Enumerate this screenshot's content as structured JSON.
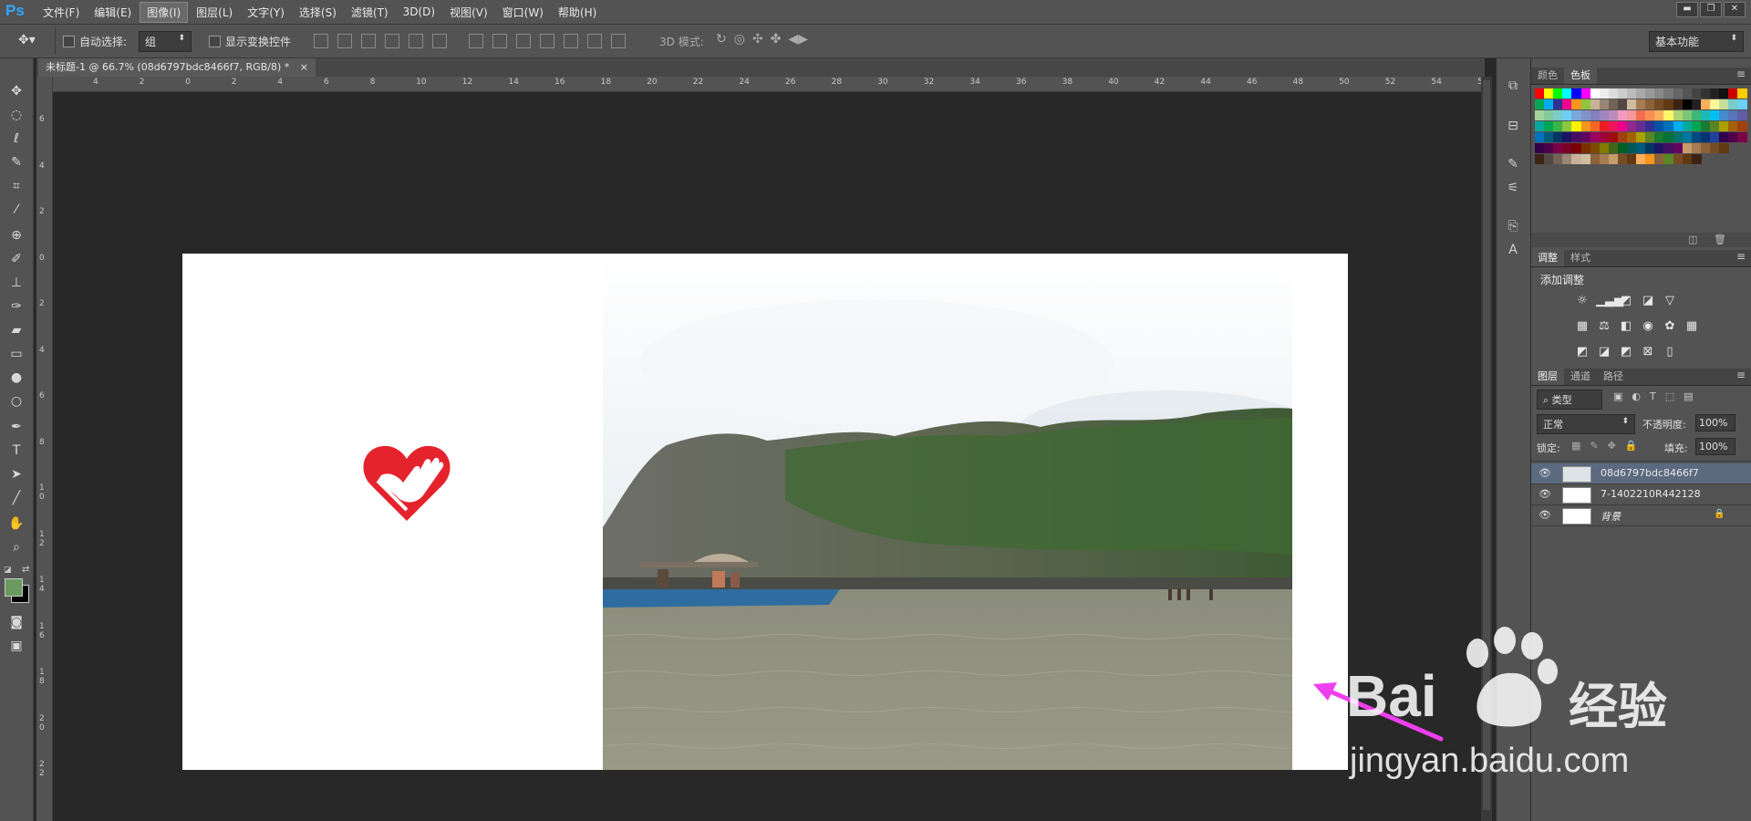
{
  "app": {
    "logo": "Ps"
  },
  "menu": {
    "items": [
      "文件(F)",
      "编辑(E)",
      "图像(I)",
      "图层(L)",
      "文字(Y)",
      "选择(S)",
      "滤镜(T)",
      "3D(D)",
      "视图(V)",
      "窗口(W)",
      "帮助(H)"
    ],
    "active_index": 2
  },
  "window_controls": {
    "minimize": "▬",
    "restore": "❐",
    "close": "✕"
  },
  "options": {
    "auto_select_label": "自动选择:",
    "auto_select_value": "组",
    "show_transform_label": "显示变换控件",
    "mode_3d_label": "3D 模式:",
    "workspace_value": "基本功能"
  },
  "document": {
    "tab_title": "未标题-1 @ 66.7% (08d6797bdc8466f7, RGB/8) *",
    "tab_close": "×"
  },
  "ruler": {
    "h_labels": [
      "4",
      "2",
      "0",
      "2",
      "4",
      "6",
      "8",
      "10",
      "12",
      "14",
      "16",
      "18",
      "20",
      "22",
      "24",
      "26",
      "28",
      "30",
      "32",
      "34",
      "36",
      "38",
      "40",
      "42",
      "44",
      "46",
      "48",
      "50",
      "52",
      "54",
      "5"
    ],
    "v_labels": [
      "6",
      "4",
      "2",
      "0",
      "2",
      "4",
      "6",
      "8",
      "10",
      "12",
      "14",
      "16",
      "18",
      "20",
      "22"
    ]
  },
  "panels": {
    "color_tab": "颜色",
    "swatches_tab": "色板",
    "adjust_tab": "调整",
    "styles_tab": "样式",
    "add_adjustment_label": "添加调整",
    "layers_tab": "图层",
    "channels_tab": "通道",
    "paths_tab": "路径",
    "kind_filter": "类型",
    "blend_mode": "正常",
    "opacity_label": "不透明度:",
    "opacity_value": "100%",
    "lock_label": "锁定:",
    "fill_label": "填充:",
    "fill_value": "100%"
  },
  "layers": [
    {
      "name": "08d6797bdc8466f7",
      "selected": true
    },
    {
      "name": "7-1402210R442128",
      "selected": false
    },
    {
      "name": "背景",
      "selected": false,
      "locked": true
    }
  ],
  "colors": {
    "foreground": "#6a9a62",
    "background": "#000000",
    "accent": "#31a8ff",
    "heart_logo": "#e5232d",
    "arrow": "#ee3fee"
  },
  "watermark": {
    "brand_left": "Bai",
    "brand_right": "经验",
    "site": "jingyan.baidu.com"
  }
}
